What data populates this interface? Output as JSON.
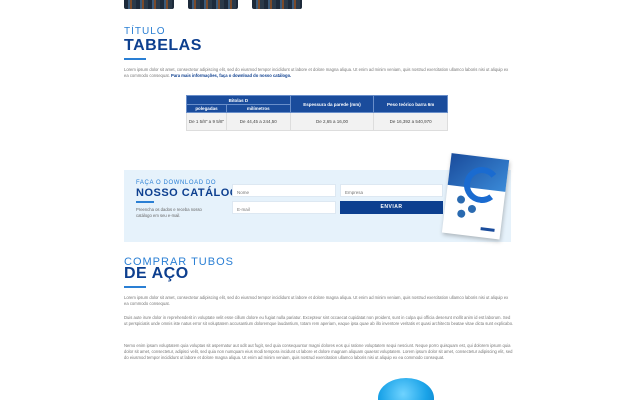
{
  "tables_section": {
    "eyebrow": "TÍTULO",
    "title": "TABELAS",
    "paragraph": "Lorem ipsum dolor sit amet, consectetur adipiscing elit, sed do eiusmod tempor incididunt ut labore et dolore magna aliqua. Ut enim ad minim veniam, quis nostrud exercitation ullamco laboris nisi ut aliquip ex ea commodo consequat.",
    "paragraph_link": "Para mais informações, faça o download do nosso catálogo."
  },
  "spec_table": {
    "group_header": "Bitolas D",
    "sub_headers": [
      "polegadas",
      "milímetros"
    ],
    "headers": [
      "Espessura da parede (mm)",
      "Peso teórico barra 6m"
    ],
    "row": {
      "inches": "De 1 5/8\" a 9 5/8\"",
      "mm": "De 44,45 a 244,50",
      "wall": "De 2,65 a 16,00",
      "weight": "De 16,392 a 540,970"
    }
  },
  "catalog_band": {
    "eyebrow": "FAÇA O DOWNLOAD DO",
    "title": "NOSSO CATÁLOGO",
    "note": "Preencha os dados e receba nosso catálogo em seu e-mail.",
    "name_placeholder": "Nome",
    "company_placeholder": "Empresa",
    "email_placeholder": "E-mail",
    "submit_label": "ENVIAR"
  },
  "buy_section": {
    "eyebrow": "COMPRAR TUBOS",
    "title": "DE AÇO",
    "p1": "Lorem ipsum dolor sit amet, consectetur adipiscing elit, sed do eiusmod tempor incididunt ut labore et dolore magna aliqua. Ut enim ad minim veniam, quis nostrud exercitation ullamco laboris nisi ut aliquip ex ea commodo consequat.",
    "p2": "Duis aute irure dolor in reprehenderit in voluptate velit esse cillum dolore eu fugiat nulla pariatur. Excepteur sint occaecat cupidatat non proident, sunt in culpa qui officia deserunt mollit anim id est laborum. Sed ut perspiciatis unde omnis iste natus error sit voluptatem accusantium doloremque laudantium, totam rem aperiam, eaque ipsa quae ab illo inventore veritatis et quasi architecto beatae vitae dicta sunt explicabo.",
    "p3": "Nemo enim ipsam voluptatem quia voluptas sit aspernatur aut odit aut fugit, sed quia consequuntur magni dolores eos qui ratione voluptatem sequi nesciunt. Neque porro quisquam est, qui dolorem ipsum quia dolor sit amet, consectetur, adipisci velit, sed quia non numquam eius modi tempora incidunt ut labore et dolore magnam aliquam quaerat voluptatem. Lorem ipsum dolor sit amet, consectetur adipiscing elit, sed do eiusmod tempor incididunt ut labore et dolore magna aliqua. Ut enim ad minim veniam, quis nostrud exercitation ullamco laboris nisi ut aliquip ex ea commodo consequat."
  },
  "colors": {
    "brand_blue": "#0d3f8f",
    "accent_blue": "#2a7fd4",
    "table_header": "#1a4c9c",
    "band_bg": "#e6f2fb"
  }
}
